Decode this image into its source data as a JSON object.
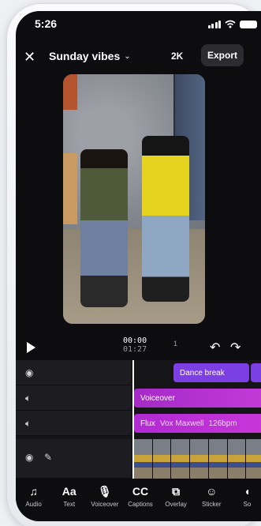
{
  "status": {
    "time": "5:26"
  },
  "header": {
    "project_title": "Sunday vibes",
    "resolution": "2K",
    "export_label": "Export"
  },
  "playback": {
    "current_time": "00:00",
    "total_time": "01:27",
    "marker": "1"
  },
  "timeline": {
    "clips": {
      "text_clip": "Dance break",
      "voiceover_clip": "Voiceover",
      "music_title": "Flux",
      "music_artist": "Vox Maxwell",
      "music_bpm": "126bpm"
    }
  },
  "toolbar": {
    "items": [
      {
        "label": "Audio",
        "icon": "music-note-icon"
      },
      {
        "label": "Text",
        "icon": "text-icon"
      },
      {
        "label": "Voiceover",
        "icon": "microphone-icon"
      },
      {
        "label": "Captions",
        "icon": "captions-icon"
      },
      {
        "label": "Overlay",
        "icon": "overlay-icon"
      },
      {
        "label": "Sticker",
        "icon": "sticker-icon"
      },
      {
        "label": "So",
        "icon": "sound-icon"
      }
    ]
  },
  "colors": {
    "clip_purple": "#7b3fe4",
    "clip_magenta": "#b12ad3",
    "background": "#0d0d10"
  }
}
